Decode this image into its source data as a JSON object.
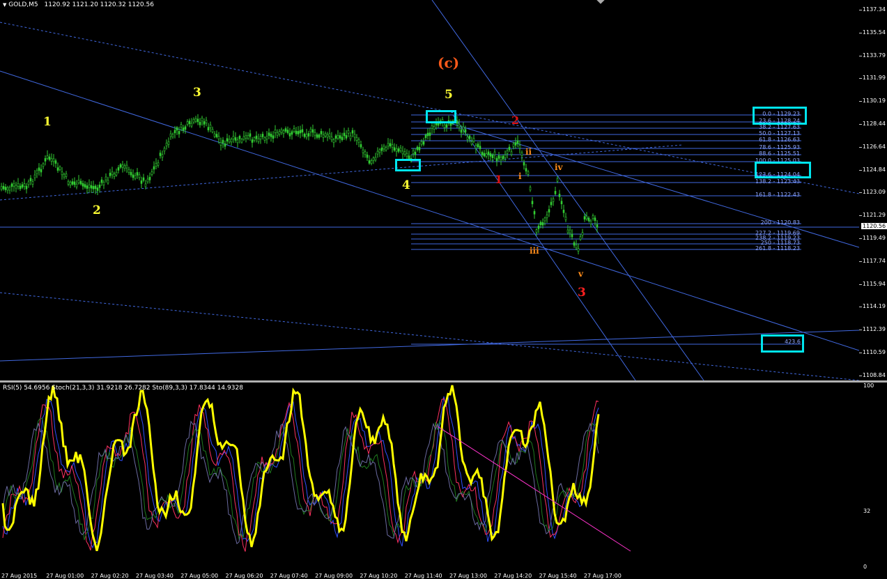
{
  "header": {
    "symbol_label": "GOLD,M5",
    "ohlc": "1120.92 1121.20 1120.32 1120.56"
  },
  "indicator_header": "RSI(5) 54.6956   Stoch(21,3,3) 31.9218 26.7282   Sto(89,3,3) 17.8344 14.9328",
  "current_price": "1120.56",
  "price_axis": [
    "1137.34",
    "1135.54",
    "1133.79",
    "1131.99",
    "1130.19",
    "1128.44",
    "1126.64",
    "1124.84",
    "1123.09",
    "1121.29",
    "1119.49",
    "1117.74",
    "1115.94",
    "1114.19",
    "1112.39",
    "1110.59",
    "1108.84"
  ],
  "osc_axis": [
    "100",
    "32",
    "0"
  ],
  "time_axis": [
    "27 Aug 2015",
    "27 Aug 01:00",
    "27 Aug 02:20",
    "27 Aug 03:40",
    "27 Aug 05:00",
    "27 Aug 06:20",
    "27 Aug 07:40",
    "27 Aug 09:00",
    "27 Aug 10:20",
    "27 Aug 11:40",
    "27 Aug 13:00",
    "27 Aug 14:20",
    "27 Aug 15:40",
    "27 Aug 17:00"
  ],
  "fib_levels": [
    "0.0 - 1129.23",
    "23.6 - 1128.24",
    "38.2 - 1127.63",
    "50.0 - 1127.13",
    "61.8 - 1126.63",
    "78.6 - 1125.93",
    "88.6 - 1125.51",
    "100.0 - 1125.03",
    "123.6 - 1124.04",
    "138.2 - 1123.43",
    "161.8 - 1122.43",
    "200 - 1120.83",
    "227.2 - 1119.69",
    "238.2 - 1119.23",
    "250 - 1118.73",
    "261.8 - 1118.23"
  ],
  "fib_extension_label": "423.6",
  "waves": {
    "yellow": [
      "1",
      "2",
      "3",
      "4",
      "5"
    ],
    "orange_c": "(c)",
    "red": [
      "1",
      "2",
      "3"
    ],
    "orange_minor": [
      "i",
      "ii",
      "iii",
      "iv",
      "v"
    ]
  },
  "colors": {
    "candle": "#32cd32",
    "rsi": "#ffff00",
    "trendline": "#4169e1",
    "highlight_box": "#00e5ee",
    "wave_yellow": "#ffff33",
    "wave_red": "#ff2020",
    "wave_orange": "#ff8c1a",
    "magenta_trend": "#ff33cc"
  }
}
